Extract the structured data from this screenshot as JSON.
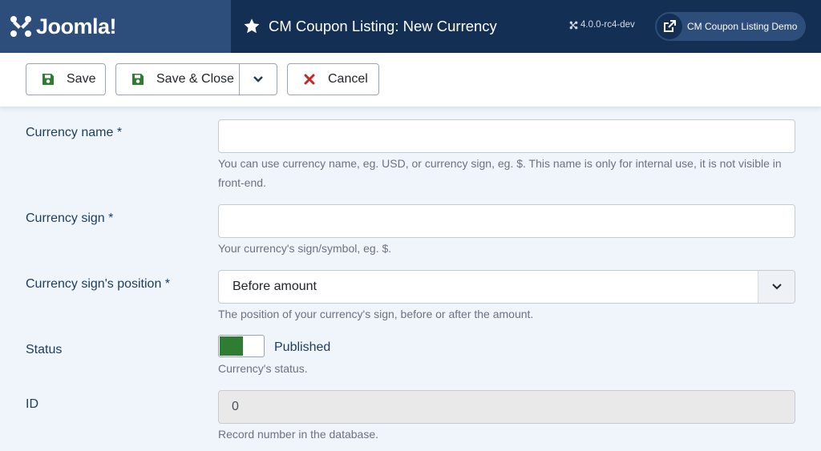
{
  "header": {
    "logo_text": "Joomla!",
    "page_title": "CM Coupon Listing: New Currency",
    "version": "4.0.0-rc4-dev",
    "site_link_label": "CM Coupon Listing Demo",
    "bg_color": "#132f53",
    "logo_bg_color": "#2d4d7a"
  },
  "toolbar": {
    "save_label": "Save",
    "save_close_label": "Save & Close",
    "cancel_label": "Cancel",
    "icons": {
      "save": "floppy-disk-icon",
      "cancel": "x-icon",
      "dropdown": "chevron-down-icon"
    }
  },
  "form": {
    "currency_name": {
      "label": "Currency name *",
      "value": "",
      "help": "You can use currency name, eg. USD, or currency sign, eg. $. This name is only for internal use, it is not visible in front-end."
    },
    "currency_sign": {
      "label": "Currency sign *",
      "value": "",
      "help": "Your currency's sign/symbol, eg. $."
    },
    "currency_position": {
      "label": "Currency sign's position *",
      "selected": "Before amount",
      "help": "The position of your currency's sign, before or after the amount."
    },
    "status": {
      "label": "Status",
      "state_label": "Published",
      "on": true,
      "on_color": "#2f7d32",
      "help": "Currency's status."
    },
    "id": {
      "label": "ID",
      "value": "0",
      "help": "Record number in the database."
    }
  }
}
